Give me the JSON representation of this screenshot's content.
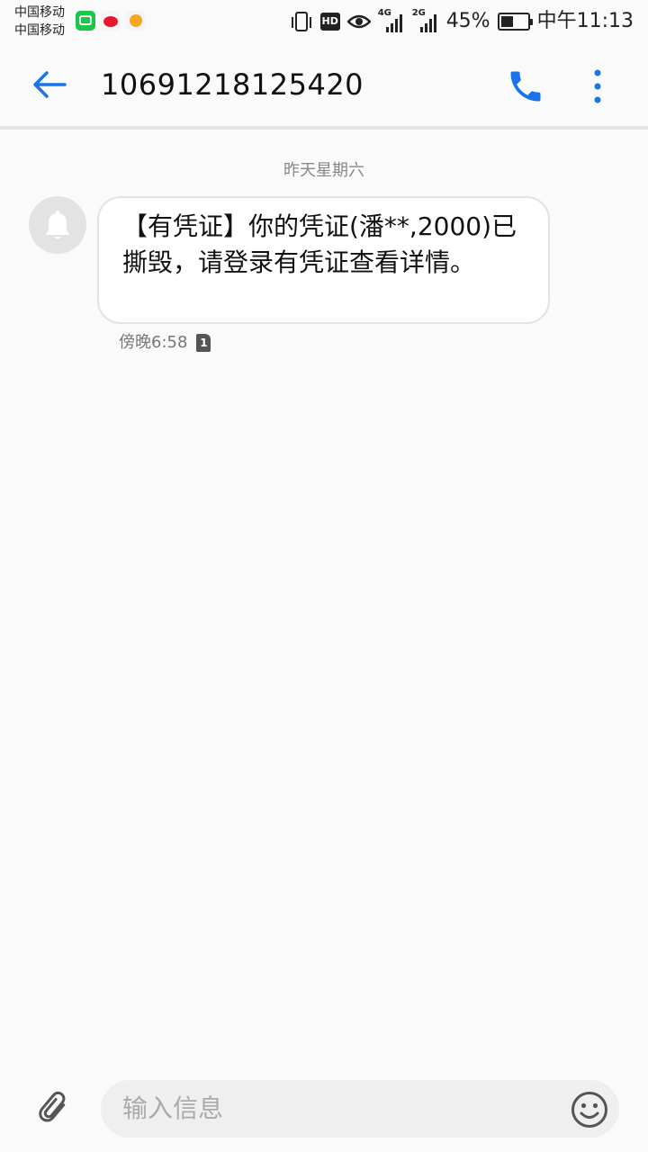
{
  "status_bar": {
    "carrier_1": "中国移动",
    "carrier_2": "中国移动",
    "app_icons": [
      "iqiyi-icon",
      "weibo-icon",
      "app-notification-icon"
    ],
    "hd_label": "HD",
    "net_label_1": "4G",
    "net_label_2": "2G",
    "battery_percent_text": "45%",
    "battery_level": 0.45,
    "time": "中午11:13"
  },
  "toolbar": {
    "back_icon": "arrow-left-icon",
    "title": "10691218125420",
    "call_icon": "phone-icon",
    "more_icon": "more-vertical-icon",
    "accent_color": "#1a73e8"
  },
  "conversation": {
    "date_divider": "昨天星期六",
    "avatar_icon": "bell-icon",
    "message": {
      "text": "【有凭证】你的凭证(潘**,2000)已撕毁，请登录有凭证查看详情。",
      "time": "傍晚6:58",
      "sim_label": "1"
    }
  },
  "input_bar": {
    "attach_icon": "paperclip-icon",
    "placeholder": "输入信息",
    "emoji_icon": "smiley-icon"
  }
}
